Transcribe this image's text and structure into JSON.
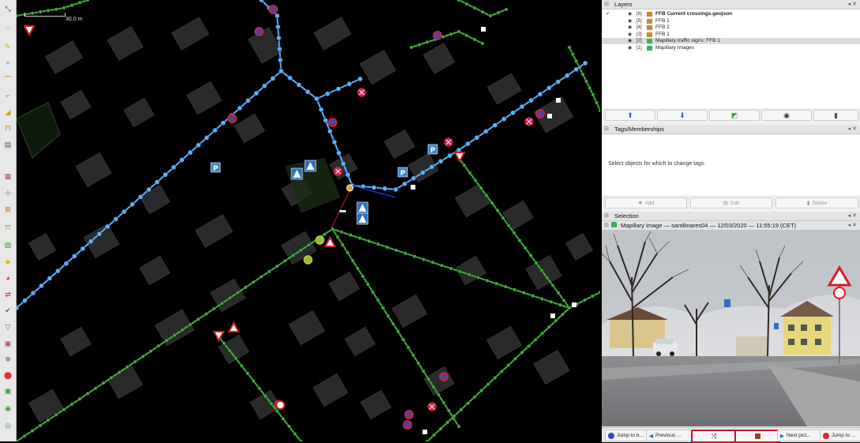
{
  "map": {
    "scale_label": "30.0 m",
    "colors": {
      "background": "#000000",
      "blue_way": "#5ab0ff",
      "green_way": "#3fb03a",
      "building": "#2a2a2a"
    }
  },
  "toolbar": {
    "tools": [
      "select-tool",
      "lasso-tool",
      "draw-tool",
      "zoom-tool",
      "way-tool",
      "area-tool",
      "measure-tool",
      "building-tool",
      "layers-tool",
      "shapes-tool",
      "crosshair-tool",
      "split-tool",
      "map-tool",
      "chat-tool",
      "globe-tool",
      "swap-tool",
      "validate-tool",
      "filter-tool",
      "paint-tool",
      "bug-tool",
      "marker-tool",
      "photo-tool",
      "green-tool",
      "green-tool-2",
      "green-tool-3"
    ]
  },
  "layers_panel": {
    "title": "Layers",
    "rows": [
      {
        "index": "[6]",
        "name": "FFB Current crossings.geojson",
        "bold": true,
        "selected": false,
        "active": true
      },
      {
        "index": "[5]",
        "name": "FFB 1",
        "bold": false,
        "selected": false,
        "active": false
      },
      {
        "index": "[4]",
        "name": "FFB 2",
        "bold": false,
        "selected": false,
        "active": false
      },
      {
        "index": "[3]",
        "name": "FFB 1",
        "bold": false,
        "selected": false,
        "active": false
      },
      {
        "index": "[2]",
        "name": "Mapillary traffic signs: FFB 1",
        "bold": false,
        "selected": true,
        "active": false
      },
      {
        "index": "[1]",
        "name": "Mapillary Images",
        "bold": false,
        "selected": false,
        "active": false
      }
    ]
  },
  "tags_panel": {
    "title": "Tags/Memberships",
    "empty_message": "Select objects for which to change tags.",
    "add_label": "Add",
    "edit_label": "Edit",
    "delete_label": "Delete"
  },
  "selection_panel": {
    "title": "Selection",
    "image_title": "Mapillary image — santilinares04 — 12/03/2020 — 11:55:19 (CET)"
  },
  "image_bar": {
    "jump_start": "Jump to b...",
    "previous": "Previous ...",
    "next": "Next pict...",
    "jump_end": "Jump to ..."
  }
}
